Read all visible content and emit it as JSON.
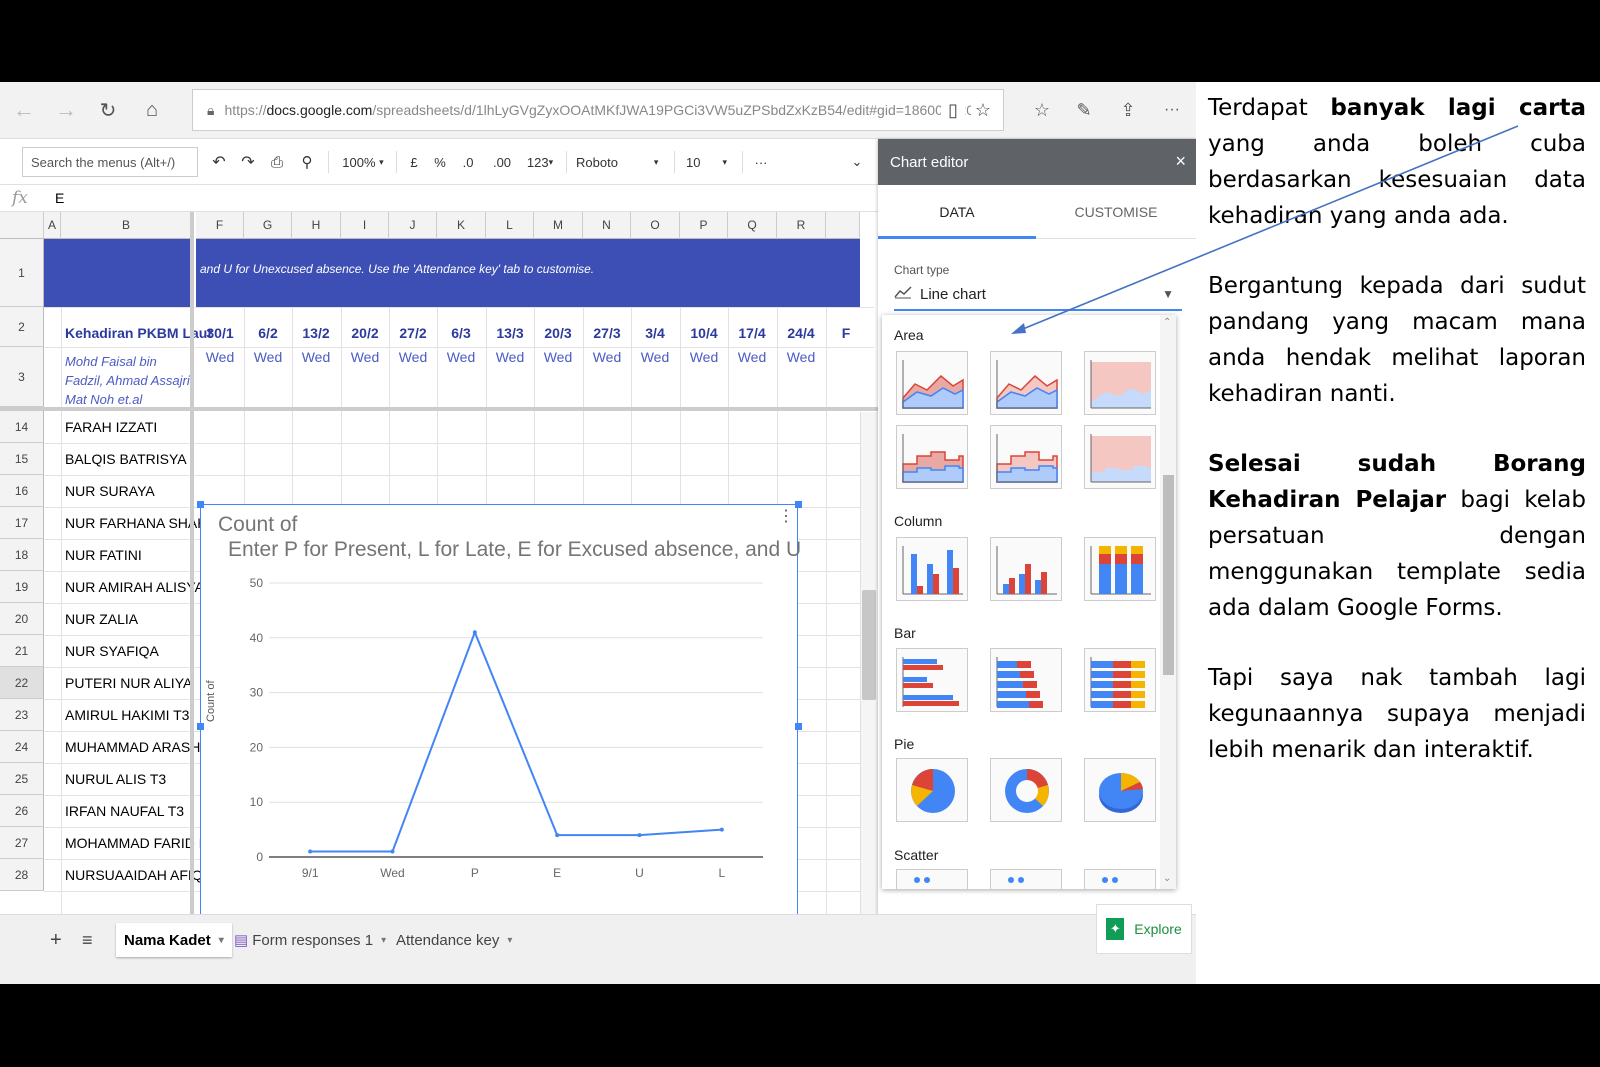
{
  "browser": {
    "url_prefix": "https://",
    "url_host": "docs.google.com",
    "url_path": "/spreadsheets/d/1lhLyGVgZyxOOAtMKfJWA19PGCi3VW5uZPSbdZxKzB54/edit#gid=186001220",
    "icons": [
      "back-icon",
      "forward-icon",
      "refresh-icon",
      "home-icon",
      "reader-icon",
      "star-icon",
      "favorites-icon",
      "pen-icon",
      "share-icon",
      "more-icon"
    ]
  },
  "toolbar": {
    "search_menus": "Search the menus (Alt+/)",
    "zoom": "100%",
    "currency": "£",
    "percent": "%",
    "dec_less": ".0",
    "dec_more": ".00",
    "format": "123",
    "font": "Roboto",
    "font_size": "10",
    "more": "···"
  },
  "formula": {
    "fx": "fx",
    "value": "E"
  },
  "columns": [
    "A",
    "B",
    "F",
    "G",
    "H",
    "I",
    "J",
    "K",
    "L",
    "M",
    "N",
    "O",
    "P",
    "Q",
    "R"
  ],
  "rows": [
    "1",
    "2",
    "3",
    "14",
    "15",
    "16",
    "17",
    "18",
    "19",
    "20",
    "21",
    "22",
    "23",
    "24",
    "25",
    "26",
    "27",
    "28"
  ],
  "header": {
    "band_text": "and U for Unexcused absence. Use the 'Attendance key' tab to customise.",
    "title_cell": "Kehadiran PKBM Laut",
    "dates": [
      "30/1",
      "6/2",
      "13/2",
      "20/2",
      "27/2",
      "6/3",
      "13/3",
      "20/3",
      "27/3",
      "3/4",
      "10/4",
      "17/4",
      "24/4"
    ],
    "overflow_date": "F",
    "weekday": "Wed",
    "note": "Mohd Faisal bin\nFadzil, Ahmad Assajri\nMat Noh et.al"
  },
  "names": [
    "FARAH IZZATI",
    "BALQIS BATRISYA",
    "NUR SURAYA",
    "NUR FARHANA SHAHI",
    "NUR FATINI",
    "NUR AMIRAH ALISYA",
    "NUR ZALIA",
    "NUR SYAFIQA",
    "PUTERI NUR ALIYA",
    "AMIRUL HAKIMI T3",
    "MUHAMMAD ARASH T",
    "NURUL ALIS T3",
    "IRFAN NAUFAL T3",
    "MOHAMMAD FARID N",
    "NURSUAAIDAH AFIQA"
  ],
  "selected_row": "22",
  "chart_data": {
    "type": "line",
    "title": "Count of",
    "subtitle": "Enter P for Present, L for Late, E for Excused absence, and U",
    "ylabel": "Count of",
    "categories": [
      "9/1",
      "Wed",
      "P",
      "E",
      "U",
      "L"
    ],
    "values": [
      1,
      1,
      41,
      4,
      4,
      5
    ],
    "ylim": [
      0,
      50
    ],
    "yticks": [
      "0",
      "10",
      "20",
      "30",
      "40",
      "50"
    ],
    "grid": true,
    "color": "#4285f4"
  },
  "editor": {
    "title": "Chart editor",
    "close": "×",
    "tab_data": "DATA",
    "tab_customise": "CUSTOMISE",
    "chart_type_label": "Chart type",
    "chart_type_value": "Line chart",
    "sections": [
      "Area",
      "Column",
      "Bar",
      "Pie",
      "Scatter"
    ]
  },
  "sheets": {
    "add": "+",
    "list": "≡",
    "tabs": [
      "Nama Kadet",
      "Form responses 1",
      "Attendance key"
    ],
    "explore": "Explore"
  },
  "commentary": {
    "p1_a": "Terdapat ",
    "p1_b": "banyak lagi carta",
    "p1_c": " yang anda boleh cuba berdasarkan kesesuaian data kehadiran yang anda ada.",
    "p2": "Bergantung kepada dari sudut pandang yang macam mana anda hendak melihat laporan kehadiran nanti.",
    "p3_a": "Selesai sudah Borang Kehadiran Pelajar",
    "p3_b": " bagi kelab persatuan dengan menggunakan template sedia ada dalam Google Forms.",
    "p4": "Tapi saya nak tambah lagi kegunaannya supaya menjadi lebih menarik dan interaktif."
  },
  "colors": {
    "band": "#3d4fb5",
    "accent": "#4285f4",
    "header_text": "#2b3a9e"
  }
}
